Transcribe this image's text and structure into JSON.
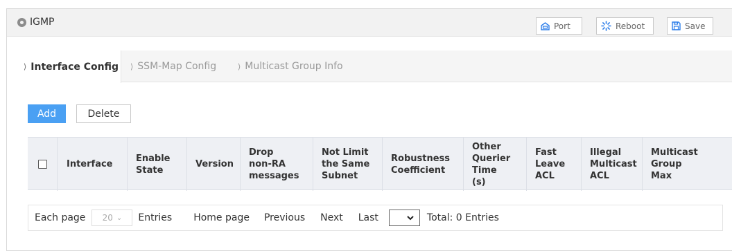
{
  "header": {
    "title": "IGMP",
    "buttons": {
      "port": "Port",
      "reboot": "Reboot",
      "save": "Save"
    }
  },
  "tabs": [
    {
      "label": "Interface Config",
      "active": true
    },
    {
      "label": "SSM-Map Config",
      "active": false
    },
    {
      "label": "Multicast Group Info",
      "active": false
    }
  ],
  "actions": {
    "add": "Add",
    "delete": "Delete"
  },
  "table": {
    "columns": [
      "Interface",
      "Enable State",
      "Version",
      "Drop non-RA messages",
      "Not Limit the Same Subnet",
      "Robustness Coefficient",
      "Other Querier Time (s)",
      "Fast Leave ACL",
      "Illegal Multicast ACL",
      "Multicast Group Max"
    ],
    "rows": []
  },
  "pagination": {
    "each_page": "Each page",
    "per_page_value": "20",
    "entries": "Entries",
    "home": "Home page",
    "previous": "Previous",
    "next": "Next",
    "last": "Last",
    "total": "Total: 0 Entries"
  },
  "colors": {
    "accent": "#4aa0f3",
    "header_bg": "#f2f2f2",
    "table_header_bg": "#eef0f4"
  }
}
